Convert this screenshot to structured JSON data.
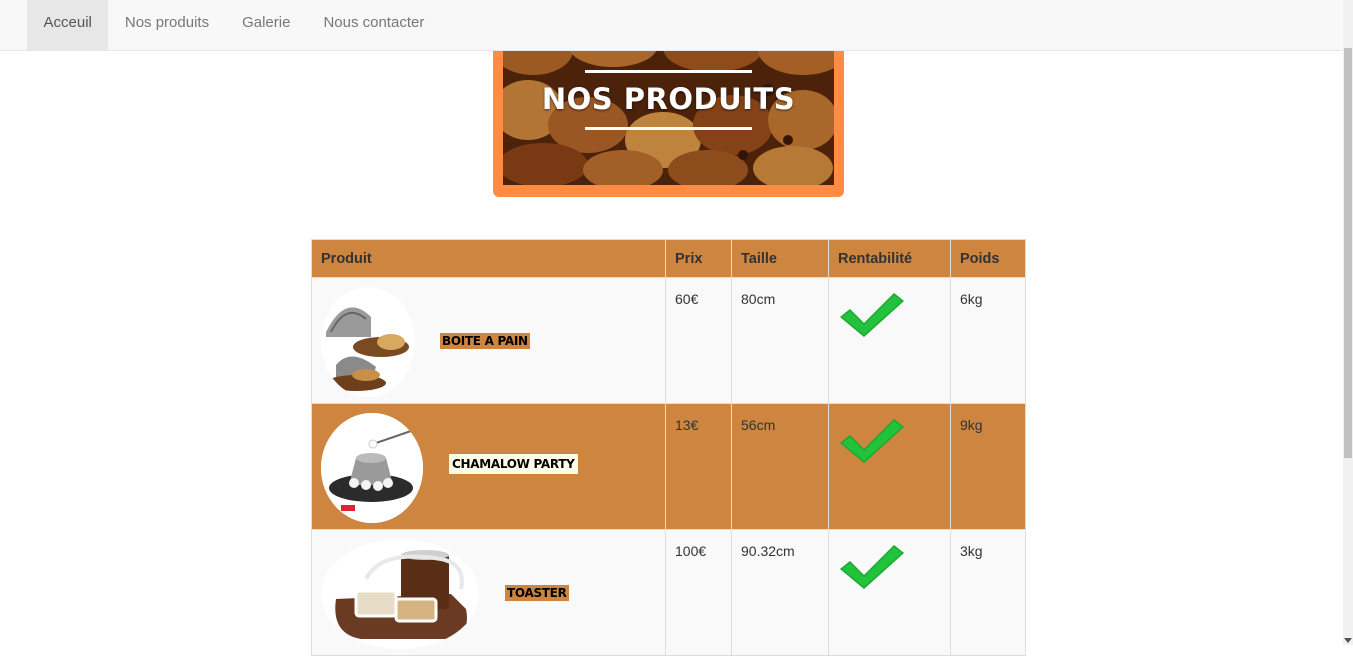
{
  "nav": {
    "items": [
      "Acceuil",
      "Nos produits",
      "Galerie",
      "Nous contacter"
    ],
    "active_index": 0
  },
  "banner": {
    "title": "NOS PRODUITS"
  },
  "table": {
    "headers": [
      "Produit",
      "Prix",
      "Taille",
      "Rentabilité",
      "Poids"
    ],
    "rows": [
      {
        "name": "BOITE A PAIN",
        "price": "60€",
        "size": "80cm",
        "profitable": true,
        "weight": "6kg",
        "label_bg": "#cd853f",
        "row_style": "light"
      },
      {
        "name": "CHAMALOW PARTY",
        "price": "13€",
        "size": "56cm",
        "profitable": true,
        "weight": "9kg",
        "label_bg": "#fffbe6",
        "row_style": "dark"
      },
      {
        "name": "TOASTER",
        "price": "100€",
        "size": "90.32cm",
        "profitable": true,
        "weight": "3kg",
        "label_bg": "#cd853f",
        "row_style": "light"
      }
    ]
  },
  "colors": {
    "header_bg": "#cd853f",
    "banner_frame": "#ff8c42",
    "check_green": "#1aa82f"
  }
}
